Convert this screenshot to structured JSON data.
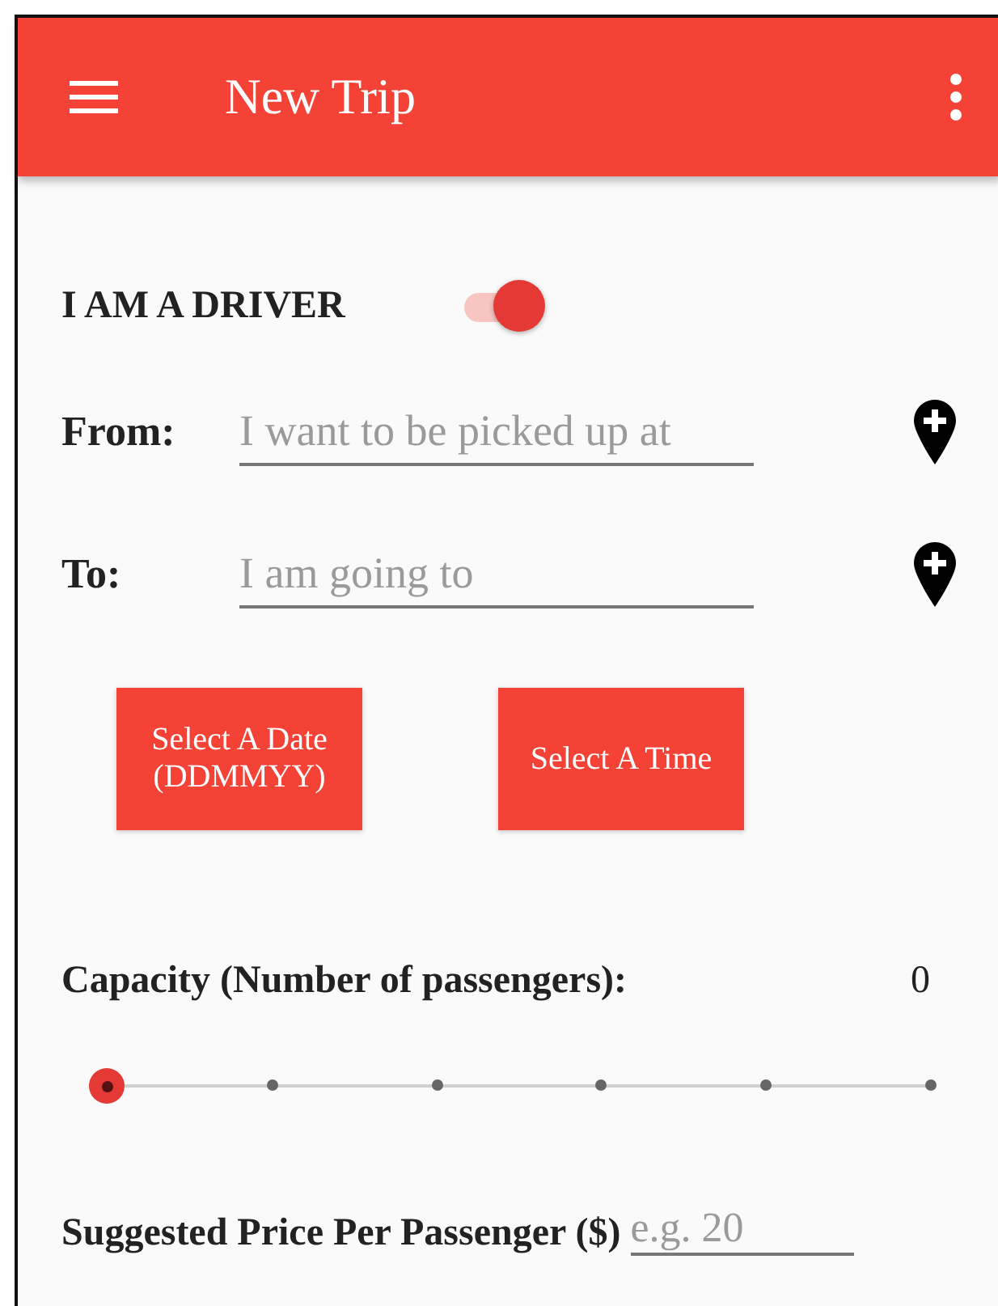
{
  "toolbar": {
    "title": "New Trip"
  },
  "driver_toggle": {
    "label": "I AM A DRIVER",
    "on": true
  },
  "locations": [
    {
      "label": "From:",
      "placeholder": "I want to be picked up at"
    },
    {
      "label": "To:",
      "placeholder": "I am going to"
    }
  ],
  "buttons": [
    {
      "lines": [
        "Select A Date",
        "(DDMMYY)"
      ]
    },
    {
      "lines": [
        "Select A Time"
      ]
    }
  ],
  "capacity": {
    "label": "Capacity (Number of passengers):",
    "value": "0",
    "level": 0
  },
  "price": {
    "label": "Suggested Price Per Passenger ($)",
    "placeholder": "e.g. 20"
  }
}
